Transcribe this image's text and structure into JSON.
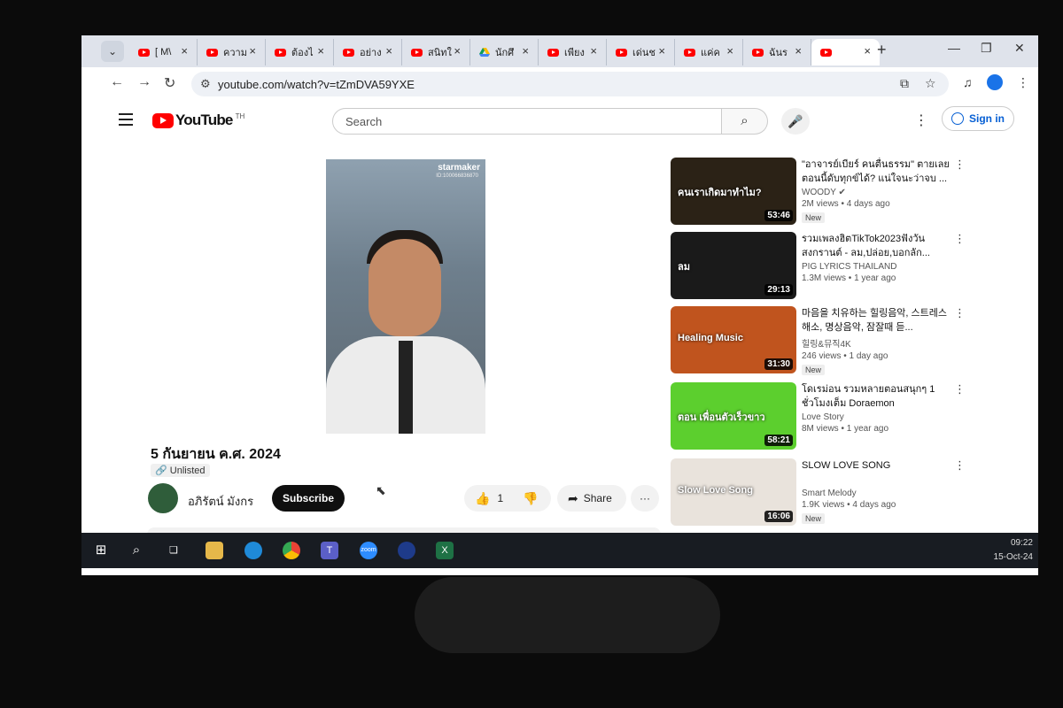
{
  "browser": {
    "tabs": [
      {
        "title": "[ M\\",
        "favicon": "youtube-icon"
      },
      {
        "title": "ความ",
        "favicon": "youtube-icon"
      },
      {
        "title": "ต้องไ",
        "favicon": "youtube-icon"
      },
      {
        "title": "อย่าง",
        "favicon": "youtube-icon"
      },
      {
        "title": "สนิทใ",
        "favicon": "youtube-icon"
      },
      {
        "title": "นักศึ",
        "favicon": "drive-icon"
      },
      {
        "title": "เพียง",
        "favicon": "youtube-icon"
      },
      {
        "title": "เด่นช",
        "favicon": "youtube-icon"
      },
      {
        "title": "แค่ค",
        "favicon": "youtube-icon"
      },
      {
        "title": "ฉันร",
        "favicon": "youtube-icon"
      },
      {
        "title": "",
        "favicon": "youtube-icon",
        "active": true
      }
    ],
    "new_tab_label": "+",
    "url": "youtube.com/watch?v=tZmDVA59YXE"
  },
  "youtube": {
    "logo_text": "YouTube",
    "country_code": "TH",
    "search_placeholder": "Search",
    "sign_in_label": "Sign in"
  },
  "video": {
    "overlay_brand": "starmaker",
    "overlay_id": "ID:100066836870",
    "title": "5 กันยายน ค.ศ. 2024",
    "visibility": "Unlisted",
    "channel": "อภิรัตน์ มังกร",
    "subscribe_label": "Subscribe",
    "likes": "1",
    "share_label": "Share"
  },
  "suggestions": [
    {
      "title": "\"อาจารย์เบียร์ คนตื่นธรรม\" ตายเลยตอนนี้ดับทุกข์ได้? แน่ใจนะว่าจบ ...",
      "channel": "WOODY",
      "verified": true,
      "views": "2M views",
      "age": "4 days ago",
      "badge": "New",
      "duration": "53:46",
      "thumb_color": "#2b2216",
      "thumb_text": "คนเราเกิดมาทำไม?"
    },
    {
      "title": "รวมเพลงฮิตTikTok2023ฟังวันสงกรานต์ - ลม,ปล่อย,บอกลัก...",
      "channel": "PIG LYRICS THAILAND",
      "verified": false,
      "views": "1.3M views",
      "age": "1 year ago",
      "badge": "",
      "duration": "29:13",
      "thumb_color": "#1a1a1a",
      "thumb_text": "ลม"
    },
    {
      "title": "마음을 치유하는 힐링음악, 스트레스 해소, 명상음악, 잠잘때 듣...",
      "channel": "힐링&뮤직4K",
      "verified": false,
      "views": "246 views",
      "age": "1 day ago",
      "badge": "New",
      "duration": "31:30",
      "thumb_color": "#c0541e",
      "thumb_text": "Healing Music"
    },
    {
      "title": "โดเรม่อน รวมหลายตอนสนุกๆ 1 ชั่วโมงเต็ม Doraemon",
      "channel": "Love Story",
      "verified": false,
      "views": "8M views",
      "age": "1 year ago",
      "badge": "",
      "duration": "58:21",
      "thumb_color": "#5ccf2e",
      "thumb_text": "ตอน เพื่อนตัวเร็วขาว"
    },
    {
      "title": "SLOW LOVE SONG",
      "channel": "Smart Melody",
      "verified": false,
      "views": "1.9K views",
      "age": "4 days ago",
      "badge": "New",
      "duration": "16:06",
      "thumb_color": "#e9e3dc",
      "thumb_text": "Slow Love Song"
    }
  ],
  "taskbar": {
    "time": "09:22",
    "date": "15-Oct-24",
    "apps": [
      "start-icon",
      "search-icon",
      "task-view-icon",
      "file-explorer-icon",
      "edge-icon",
      "chrome-icon",
      "teams-icon",
      "zoom-icon",
      "webex-icon",
      "excel-icon"
    ]
  }
}
